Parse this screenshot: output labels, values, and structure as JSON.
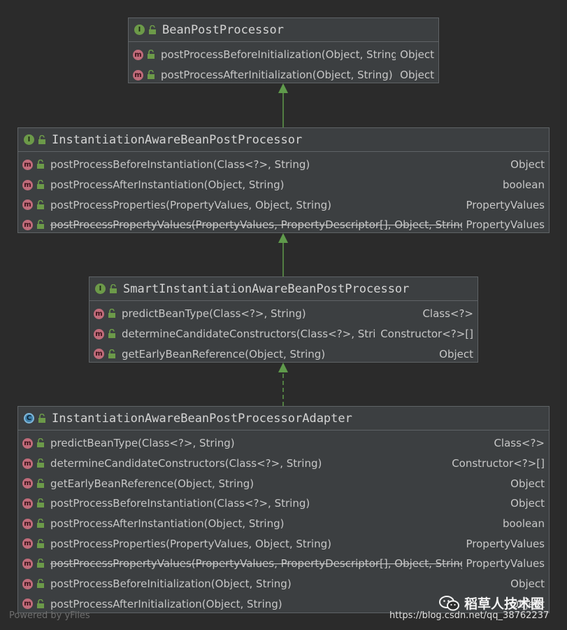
{
  "boxes": [
    {
      "id": "bpp",
      "title": "BeanPostProcessor",
      "badge": "I",
      "badge_kind": "interface",
      "methods": [
        {
          "sig": "postProcessBeforeInitialization(Object, String)",
          "ret": "Object",
          "deprecated": false
        },
        {
          "sig": "postProcessAfterInitialization(Object, String)",
          "ret": "Object",
          "deprecated": false
        }
      ]
    },
    {
      "id": "iabpp",
      "title": "InstantiationAwareBeanPostProcessor",
      "badge": "I",
      "badge_kind": "interface",
      "methods": [
        {
          "sig": "postProcessBeforeInstantiation(Class<?>, String)",
          "ret": "Object",
          "deprecated": false
        },
        {
          "sig": "postProcessAfterInstantiation(Object, String)",
          "ret": "boolean",
          "deprecated": false
        },
        {
          "sig": "postProcessProperties(PropertyValues, Object, String)",
          "ret": "PropertyValues",
          "deprecated": false
        },
        {
          "sig": "postProcessPropertyValues(PropertyValues, PropertyDescriptor[], Object, String)",
          "ret": "PropertyValues",
          "deprecated": true
        }
      ]
    },
    {
      "id": "siabpp",
      "title": "SmartInstantiationAwareBeanPostProcessor",
      "badge": "I",
      "badge_kind": "interface",
      "methods": [
        {
          "sig": "predictBeanType(Class<?>, String)",
          "ret": "Class<?>",
          "deprecated": false
        },
        {
          "sig": "determineCandidateConstructors(Class<?>, String)",
          "ret": "Constructor<?>[]",
          "deprecated": false
        },
        {
          "sig": "getEarlyBeanReference(Object, String)",
          "ret": "Object",
          "deprecated": false
        }
      ]
    },
    {
      "id": "adapter",
      "title": "InstantiationAwareBeanPostProcessorAdapter",
      "badge": "C",
      "badge_kind": "abstract-class",
      "methods": [
        {
          "sig": "predictBeanType(Class<?>, String)",
          "ret": "Class<?>",
          "deprecated": false
        },
        {
          "sig": "determineCandidateConstructors(Class<?>, String)",
          "ret": "Constructor<?>[]",
          "deprecated": false
        },
        {
          "sig": "getEarlyBeanReference(Object, String)",
          "ret": "Object",
          "deprecated": false
        },
        {
          "sig": "postProcessBeforeInstantiation(Class<?>, String)",
          "ret": "Object",
          "deprecated": false
        },
        {
          "sig": "postProcessAfterInstantiation(Object, String)",
          "ret": "boolean",
          "deprecated": false
        },
        {
          "sig": "postProcessProperties(PropertyValues, Object, String)",
          "ret": "PropertyValues",
          "deprecated": false
        },
        {
          "sig": "postProcessPropertyValues(PropertyValues, PropertyDescriptor[], Object, String)",
          "ret": "PropertyValues",
          "deprecated": true
        },
        {
          "sig": "postProcessBeforeInitialization(Object, String)",
          "ret": "Object",
          "deprecated": false
        },
        {
          "sig": "postProcessAfterInitialization(Object, String)",
          "ret": "Object",
          "deprecated": false
        }
      ]
    }
  ],
  "method_badge": "m",
  "edges": [
    {
      "from": "iabpp",
      "to": "bpp",
      "kind": "extends"
    },
    {
      "from": "siabpp",
      "to": "iabpp",
      "kind": "extends"
    },
    {
      "from": "adapter",
      "to": "siabpp",
      "kind": "implements"
    }
  ],
  "colors": {
    "background": "#2b2b2b",
    "box": "#3c3f41",
    "border": "#5f6366",
    "edge": "#5f9a4b",
    "interface_badge": "#6c9a49",
    "method_badge": "#c06b7a",
    "class_badge": "#3d7ea8"
  },
  "icons": {
    "visibility": "unlock-icon",
    "watermark": "wechat-icon"
  },
  "footer": {
    "powered_by": "Powered by yFiles",
    "watermark_text": "稻草人技术圈",
    "url": "https://blog.csdn.net/qq_38762237"
  }
}
